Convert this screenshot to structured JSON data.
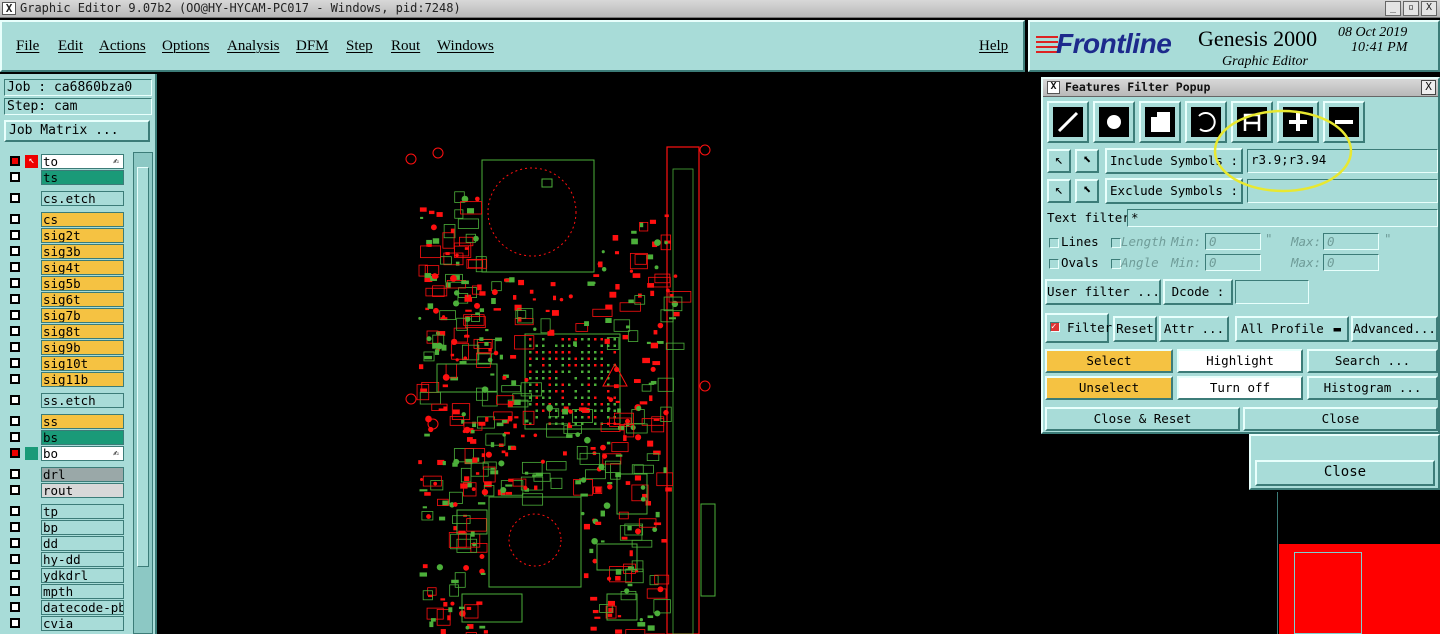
{
  "titlebar": {
    "title": "Graphic Editor 9.07b2 (OO@HY-HYCAM-PC017 - Windows, pid:7248)",
    "minimize": "_",
    "maximize": "▫",
    "close": "X"
  },
  "menu": {
    "items": [
      "File",
      "Edit",
      "Actions",
      "Options",
      "Analysis",
      "DFM",
      "Step",
      "Rout",
      "Windows"
    ],
    "help": "Help"
  },
  "brand": {
    "logo": "Frontline",
    "product": "Genesis 2000",
    "subtitle": "Graphic Editor",
    "date": "08 Oct 2019",
    "time": "10:41 PM"
  },
  "job": {
    "job_label": "Job : ca6860bza0",
    "step_label": "Step: cam",
    "job_matrix": "Job Matrix ..."
  },
  "layers": [
    {
      "name": "to",
      "color": "#ffffff",
      "state": "red",
      "pointer": true,
      "flag": "✍"
    },
    {
      "name": "ts",
      "color": "#1a9a78",
      "state": "empty"
    },
    {
      "name": "cs.etch",
      "color": "#a8dcd8",
      "state": "empty",
      "gap": true
    },
    {
      "name": "cs",
      "color": "#f5c242",
      "state": "empty",
      "gap": true
    },
    {
      "name": "sig2t",
      "color": "#f5c242",
      "state": "empty"
    },
    {
      "name": "sig3b",
      "color": "#f5c242",
      "state": "empty"
    },
    {
      "name": "sig4t",
      "color": "#f5c242",
      "state": "empty"
    },
    {
      "name": "sig5b",
      "color": "#f5c242",
      "state": "empty"
    },
    {
      "name": "sig6t",
      "color": "#f5c242",
      "state": "empty"
    },
    {
      "name": "sig7b",
      "color": "#f5c242",
      "state": "empty"
    },
    {
      "name": "sig8t",
      "color": "#f5c242",
      "state": "empty"
    },
    {
      "name": "sig9b",
      "color": "#f5c242",
      "state": "empty"
    },
    {
      "name": "sig10t",
      "color": "#f5c242",
      "state": "empty"
    },
    {
      "name": "sig11b",
      "color": "#f5c242",
      "state": "empty"
    },
    {
      "name": "ss.etch",
      "color": "#a8dcd8",
      "state": "empty",
      "gap": true
    },
    {
      "name": "ss",
      "color": "#f5c242",
      "state": "empty",
      "gap": true
    },
    {
      "name": "bs",
      "color": "#1a9a78",
      "state": "empty"
    },
    {
      "name": "bo",
      "color": "#ffffff",
      "state": "red",
      "flag": "✍",
      "swatch": "#1a9a78"
    },
    {
      "name": "drl",
      "color": "#9aa8a8",
      "state": "empty",
      "gap": true
    },
    {
      "name": "rout",
      "color": "#d8d8d8",
      "state": "empty"
    },
    {
      "name": "tp",
      "color": "#a8dcd8",
      "state": "empty",
      "gap": true
    },
    {
      "name": "bp",
      "color": "#a8dcd8",
      "state": "empty"
    },
    {
      "name": "dd",
      "color": "#a8dcd8",
      "state": "empty"
    },
    {
      "name": "hy-dd",
      "color": "#a8dcd8",
      "state": "empty"
    },
    {
      "name": "ydkdrl",
      "color": "#a8dcd8",
      "state": "empty"
    },
    {
      "name": "mpth",
      "color": "#a8dcd8",
      "state": "empty"
    },
    {
      "name": "datecode-pbe",
      "color": "#a8dcd8",
      "state": "empty"
    },
    {
      "name": "cvia",
      "color": "#a8dcd8",
      "state": "empty"
    }
  ],
  "popup": {
    "title": "Features Filter Popup",
    "close": "X",
    "feature_icons": [
      "line-icon",
      "pad-icon",
      "surface-icon",
      "arc-icon",
      "text-icon",
      "positive-icon",
      "negative-icon"
    ],
    "include_label": "Include Symbols :",
    "include_value": "r3.9;r3.94",
    "exclude_label": "Exclude Symbols :",
    "exclude_value": "",
    "text_filter_label": "Text filter",
    "text_filter_value": "*",
    "lines_label": "Lines",
    "ovals_label": "Ovals",
    "length_label": "Length",
    "angle_label": "Angle",
    "min_label": "Min:",
    "max_label": "Max:",
    "length_min": "0",
    "length_max": "0",
    "angle_min": "0",
    "angle_max": "0",
    "user_filter": "User filter ...",
    "dcode": "Dcode :",
    "dcode_value": "",
    "filter": "Filter",
    "reset": "Reset",
    "attr": "Attr ...",
    "profile": "All Profile",
    "advanced": "Advanced...",
    "select": "Select",
    "unselect": "Unselect",
    "highlight": "Highlight",
    "turn_off": "Turn off",
    "search": "Search ...",
    "histogram": "Histogram ...",
    "close_reset": "Close & Reset",
    "close_btn": "Close"
  },
  "close_window": {
    "label": "Close"
  },
  "colors": {
    "panel": "#a8dcd8",
    "accent_yellow": "#f5c242",
    "pcb_green": "#4caf3a",
    "pcb_red": "#ff1010",
    "annotation": "#e8e830"
  }
}
